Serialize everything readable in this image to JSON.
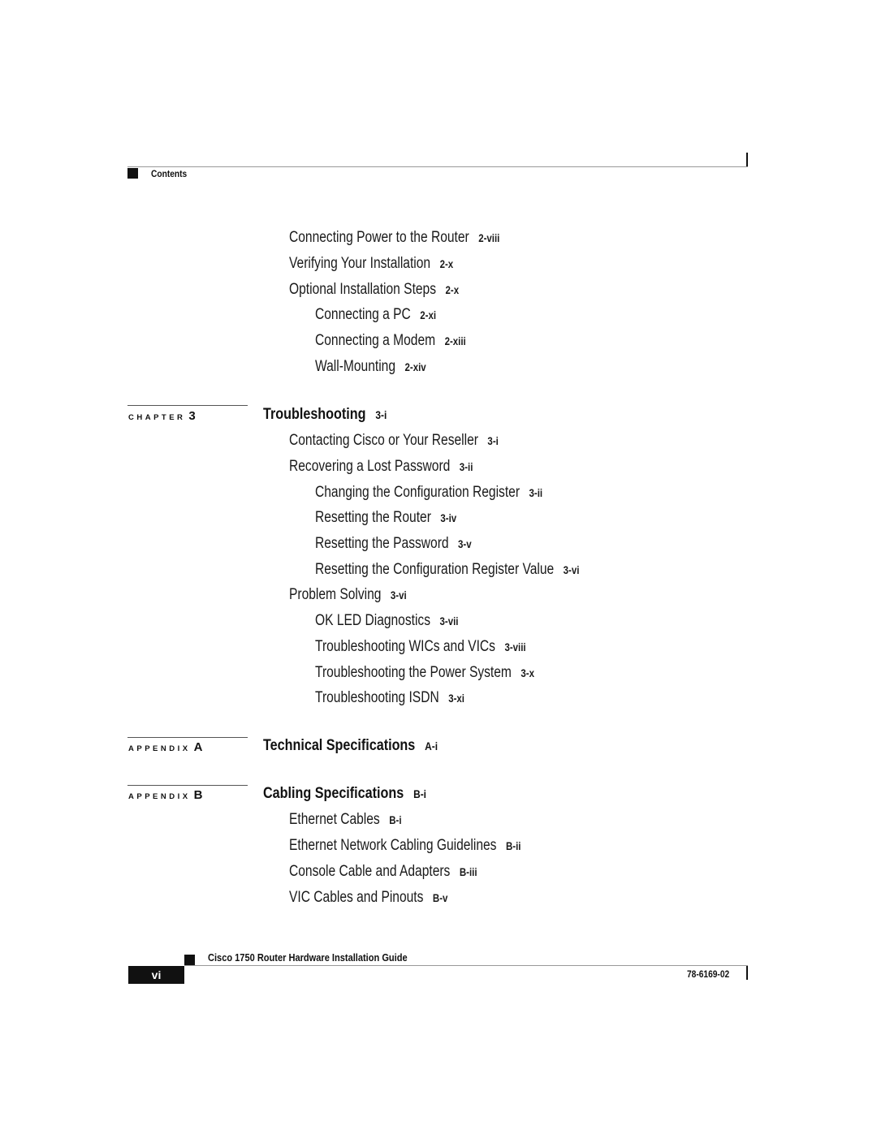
{
  "header": {
    "section": "Contents"
  },
  "toc": {
    "continued_entries": [
      {
        "title": "Connecting Power to the Router",
        "page": "2-viii",
        "level": 1
      },
      {
        "title": "Verifying Your Installation",
        "page": "2-x",
        "level": 1
      },
      {
        "title": "Optional Installation Steps",
        "page": "2-x",
        "level": 1
      },
      {
        "title": "Connecting a PC",
        "page": "2-xi",
        "level": 2
      },
      {
        "title": "Connecting a Modem",
        "page": "2-xiii",
        "level": 2
      },
      {
        "title": "Wall-Mounting",
        "page": "2-xiv",
        "level": 2
      }
    ],
    "chapter3": {
      "kind": "CHAPTER",
      "number": "3",
      "title": "Troubleshooting",
      "page": "3-i",
      "entries": [
        {
          "title": "Contacting Cisco or Your Reseller",
          "page": "3-i",
          "level": 1
        },
        {
          "title": "Recovering a Lost Password",
          "page": "3-ii",
          "level": 1
        },
        {
          "title": "Changing the Configuration Register",
          "page": "3-ii",
          "level": 2
        },
        {
          "title": "Resetting the Router",
          "page": "3-iv",
          "level": 2
        },
        {
          "title": "Resetting the Password",
          "page": "3-v",
          "level": 2
        },
        {
          "title": "Resetting the Configuration Register Value",
          "page": "3-vi",
          "level": 2
        },
        {
          "title": "Problem Solving",
          "page": "3-vi",
          "level": 1
        },
        {
          "title": "OK LED Diagnostics",
          "page": "3-vii",
          "level": 2
        },
        {
          "title": "Troubleshooting WICs and VICs",
          "page": "3-viii",
          "level": 2
        },
        {
          "title": "Troubleshooting the Power System",
          "page": "3-x",
          "level": 2
        },
        {
          "title": "Troubleshooting ISDN",
          "page": "3-xi",
          "level": 2
        }
      ]
    },
    "appendixA": {
      "kind": "APPENDIX",
      "number": "A",
      "title": "Technical Specifications",
      "page": "A-i"
    },
    "appendixB": {
      "kind": "APPENDIX",
      "number": "B",
      "title": "Cabling Specifications",
      "page": "B-i",
      "entries": [
        {
          "title": "Ethernet Cables",
          "page": "B-i",
          "level": 1
        },
        {
          "title": "Ethernet Network Cabling Guidelines",
          "page": "B-ii",
          "level": 1
        },
        {
          "title": "Console Cable and Adapters",
          "page": "B-iii",
          "level": 1
        },
        {
          "title": "VIC Cables and Pinouts",
          "page": "B-v",
          "level": 1
        }
      ]
    }
  },
  "footer": {
    "guide_title": "Cisco 1750 Router Hardware Installation Guide",
    "page_number": "vi",
    "doc_code": "78-6169-02"
  }
}
